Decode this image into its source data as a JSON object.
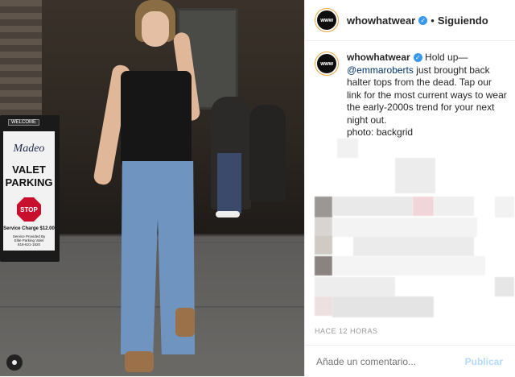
{
  "post": {
    "account": "whowhatwear",
    "avatar_text": "www",
    "follow_separator": "•",
    "follow_state": "Siguiendo",
    "verified_icon": "verified-badge-icon",
    "caption_user": "whowhatwear",
    "caption_before_mention": "Hold up—",
    "caption_mention": "@emmaroberts",
    "caption_after_mention": " just brought back halter tops from the dead. Tap our link for the most current ways to wear the early-2000s trend for your next night out.",
    "caption_credit": "photo: backgrid",
    "timestamp": "HACE 12 HORAS",
    "comment_placeholder": "Añade un comentario...",
    "publish_label": "Publicar"
  },
  "photo": {
    "sign_welcome": "WELCOME",
    "sign_brand": "Madeo",
    "sign_valet": "VALET",
    "sign_parking": "PARKING",
    "sign_stop": "STOP",
    "sign_charge": "Service Charge $12.00",
    "sign_fine1": "Service Provided By",
    "sign_fine2": "Elite Parking Valet",
    "sign_fine3": "818-621-1820"
  },
  "colors": {
    "link": "#003569",
    "verified": "#3897f0",
    "publish_disabled": "#b3dbff",
    "avatar_ring": "#e8a33d"
  }
}
